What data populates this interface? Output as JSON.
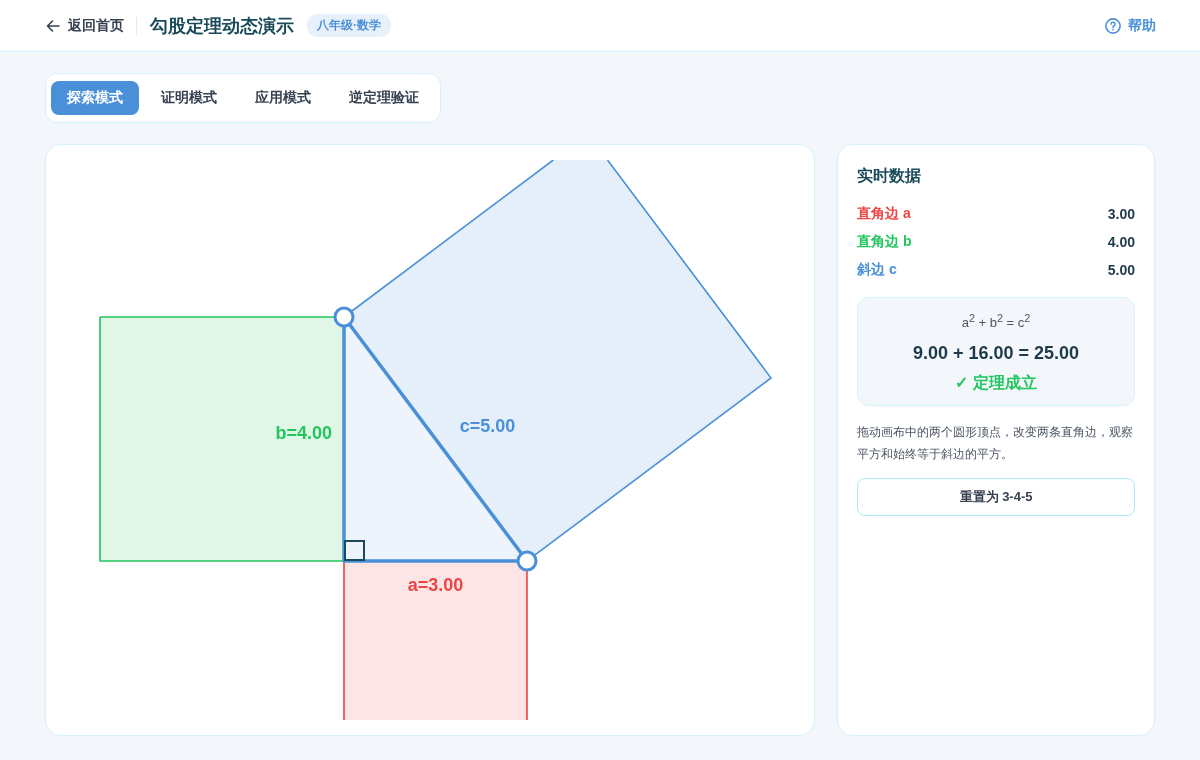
{
  "header": {
    "back_link": "返回首页",
    "title": "勾股定理动态演示",
    "badge": "八年级·数学",
    "help": "帮助"
  },
  "tabs": [
    {
      "label": "探索模式",
      "selected": true
    },
    {
      "label": "证明模式",
      "selected": false
    },
    {
      "label": "应用模式",
      "selected": false
    },
    {
      "label": "逆定理验证",
      "selected": false
    }
  ],
  "canvas": {
    "sides": [
      {
        "kind": "leg_b",
        "label": "b=4.00",
        "color": "#22c55e"
      },
      {
        "kind": "leg_a",
        "label": "a=3.00",
        "color": "#ef4444"
      },
      {
        "kind": "hypotenuse",
        "label": "c=5.00",
        "color": "#4a90d9"
      }
    ]
  },
  "panel": {
    "title": "实时数据",
    "rows": [
      {
        "label": "直角边 a",
        "value": "3.00",
        "color": "#ef4444"
      },
      {
        "label": "直角边 b",
        "value": "4.00",
        "color": "#22c55e"
      },
      {
        "label": "斜边 c",
        "value": "5.00",
        "color": "#4a90d9"
      }
    ],
    "formula": "a$^{2}$ + b$^{2}$ = c$^{2}$",
    "equation": "9.00 + 16.00 = 25.00",
    "result": "✓ 定理成立",
    "hint": "拖动画布中的两个圆形顶点，改变两条直角边，观察平方和始终等于斜边的平方。",
    "reset_button": "重置为 3-4-5"
  }
}
